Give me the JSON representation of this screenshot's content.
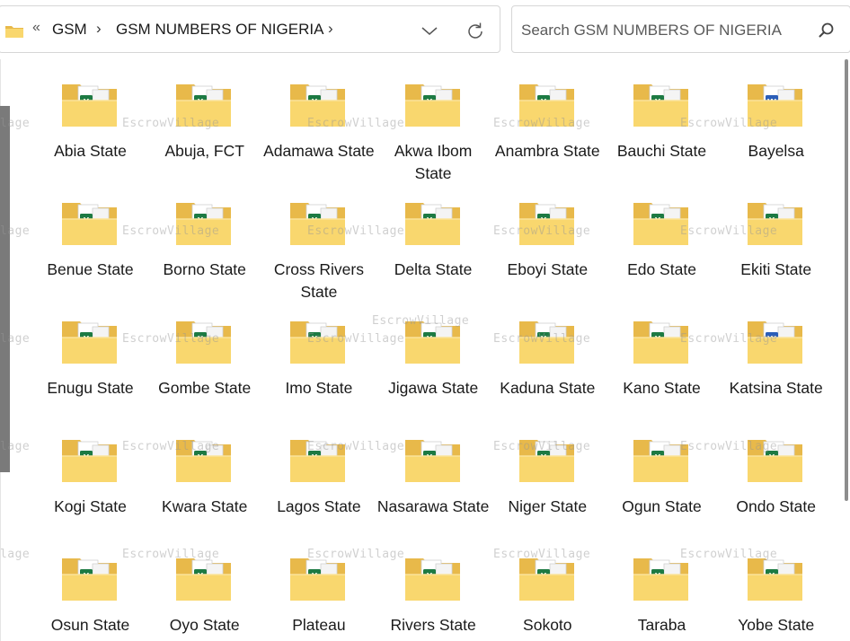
{
  "address_bar": {
    "overflow_glyph": "«",
    "crumbs": [
      "GSM",
      "GSM NUMBERS OF NIGERIA"
    ],
    "separator": "›",
    "trailing_separator": "›"
  },
  "search": {
    "placeholder": "Search GSM NUMBERS OF NIGERIA"
  },
  "colors": {
    "folder_back": "#e8b94a",
    "folder_front": "#f9d76e",
    "excel_green": "#1d7a43",
    "word_blue": "#2b5eb8",
    "accent_border": "#d6d6d6"
  },
  "watermark": "EscrowVillage",
  "folders": [
    {
      "label": "Abia State",
      "badge": "excel"
    },
    {
      "label": "Abuja, FCT",
      "badge": "excel"
    },
    {
      "label": "Adamawa State",
      "badge": "excel"
    },
    {
      "label": "Akwa Ibom State",
      "badge": "excel"
    },
    {
      "label": "Anambra State",
      "badge": "excel"
    },
    {
      "label": "Bauchi State",
      "badge": "excel"
    },
    {
      "label": "Bayelsa",
      "badge": "word"
    },
    {
      "label": "Benue State",
      "badge": "excel"
    },
    {
      "label": "Borno State",
      "badge": "excel"
    },
    {
      "label": "Cross Rivers State",
      "badge": "excel"
    },
    {
      "label": "Delta State",
      "badge": "excel"
    },
    {
      "label": "Eboyi State",
      "badge": "excel"
    },
    {
      "label": "Edo State",
      "badge": "excel"
    },
    {
      "label": "Ekiti State",
      "badge": "excel"
    },
    {
      "label": "Enugu State",
      "badge": "excel"
    },
    {
      "label": "Gombe State",
      "badge": "excel"
    },
    {
      "label": "Imo State",
      "badge": "excel"
    },
    {
      "label": "Jigawa State",
      "badge": "excel"
    },
    {
      "label": "Kaduna State",
      "badge": "excel"
    },
    {
      "label": "Kano State",
      "badge": "excel"
    },
    {
      "label": "Katsina State",
      "badge": "word"
    },
    {
      "label": "Kogi State",
      "badge": "excel"
    },
    {
      "label": "Kwara State",
      "badge": "excel"
    },
    {
      "label": "Lagos State",
      "badge": "excel"
    },
    {
      "label": "Nasarawa State",
      "badge": "excel"
    },
    {
      "label": "Niger State",
      "badge": "excel"
    },
    {
      "label": "Ogun State",
      "badge": "excel"
    },
    {
      "label": "Ondo State",
      "badge": "excel"
    },
    {
      "label": "Osun State",
      "badge": "excel"
    },
    {
      "label": "Oyo State",
      "badge": "excel"
    },
    {
      "label": "Plateau",
      "badge": "excel"
    },
    {
      "label": "Rivers State",
      "badge": "excel"
    },
    {
      "label": "Sokoto",
      "badge": "excel"
    },
    {
      "label": "Taraba",
      "badge": "excel"
    },
    {
      "label": "Yobe State",
      "badge": "excel"
    }
  ]
}
